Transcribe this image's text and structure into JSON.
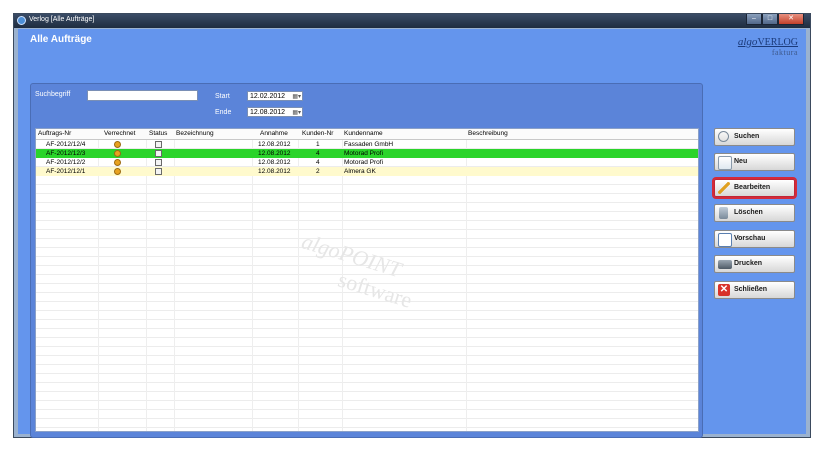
{
  "window": {
    "title": "Verlog [Alle Aufträge]",
    "controls": [
      "–",
      "□",
      "✕"
    ]
  },
  "page": {
    "heading": "Alle Aufträge"
  },
  "logo": {
    "brand_italic": "algo",
    "brand_rest": "VERLOG",
    "subtitle": "faktura"
  },
  "filters": {
    "search_label": "Suchbegriff",
    "search_value": "",
    "start_label": "Start",
    "start_value": "12.02.2012",
    "end_label": "Ende",
    "end_value": "12.08.2012"
  },
  "table": {
    "columns": [
      "Auftrags-Nr",
      "Verrechnet",
      "Status",
      "Bezeichnung",
      "Annahme",
      "Kunden-Nr",
      "Kundenname",
      "Beschreibung"
    ],
    "rows": [
      {
        "auftrag": "AF-2012/12/4",
        "bezeichnung": "",
        "annahme": "12.08.2012",
        "kunden_nr": "1",
        "kundenname": "Fassaden GmbH",
        "beschreibung": "",
        "state": "normal"
      },
      {
        "auftrag": "AF-2012/12/3",
        "bezeichnung": "",
        "annahme": "12.08.2012",
        "kunden_nr": "4",
        "kundenname": "Motorad Profi",
        "beschreibung": "",
        "state": "selected"
      },
      {
        "auftrag": "AF-2012/12/2",
        "bezeichnung": "",
        "annahme": "12.08.2012",
        "kunden_nr": "4",
        "kundenname": "Motorad Profi",
        "beschreibung": "",
        "state": "normal"
      },
      {
        "auftrag": "AF-2012/12/1",
        "bezeichnung": "",
        "annahme": "12.08.2012",
        "kunden_nr": "2",
        "kundenname": "Almera GK",
        "beschreibung": "",
        "state": "highlight"
      }
    ]
  },
  "watermark": {
    "line1": "algoPOINT",
    "line2": "software"
  },
  "buttons": {
    "suchen": "Suchen",
    "neu": "Neu",
    "bearbeiten": "Bearbeiten",
    "loeschen": "Löschen",
    "vorschau": "Vorschau",
    "drucken": "Drucken",
    "schliessen": "Schließen"
  },
  "colors": {
    "selected_row": "#2bd42b",
    "highlight_row": "#fffacd",
    "active_button_outline": "#d42a3a",
    "background": "#6495ed"
  }
}
